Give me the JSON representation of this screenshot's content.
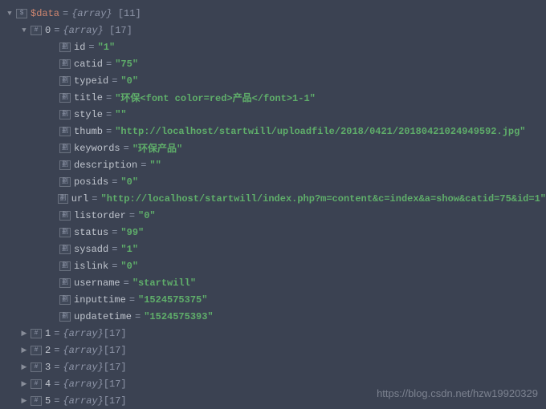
{
  "root": {
    "name": "$data",
    "type": "{array}",
    "count": "[11]"
  },
  "item0": {
    "key": "0",
    "type": "{array}",
    "count": "[17]"
  },
  "fields": [
    {
      "key": "id",
      "value": "\"1\""
    },
    {
      "key": "catid",
      "value": "\"75\""
    },
    {
      "key": "typeid",
      "value": "\"0\""
    },
    {
      "key": "title",
      "value": "\"环保<font color=red>产品</font>1-1\""
    },
    {
      "key": "style",
      "value": "\"\""
    },
    {
      "key": "thumb",
      "value": "\"http://localhost/startwill/uploadfile/2018/0421/20180421024949592.jpg\""
    },
    {
      "key": "keywords",
      "value": "\"环保产品\""
    },
    {
      "key": "description",
      "value": "\"\""
    },
    {
      "key": "posids",
      "value": "\"0\""
    },
    {
      "key": "url",
      "value": "\"http://localhost/startwill/index.php?m=content&c=index&a=show&catid=75&id=1\""
    },
    {
      "key": "listorder",
      "value": "\"0\""
    },
    {
      "key": "status",
      "value": "\"99\""
    },
    {
      "key": "sysadd",
      "value": "\"1\""
    },
    {
      "key": "islink",
      "value": "\"0\""
    },
    {
      "key": "username",
      "value": "\"startwill\""
    },
    {
      "key": "inputtime",
      "value": "\"1524575375\""
    },
    {
      "key": "updatetime",
      "value": "\"1524575393\""
    }
  ],
  "siblings": [
    {
      "key": "1",
      "type": "{array}",
      "count": "[17]"
    },
    {
      "key": "2",
      "type": "{array}",
      "count": "[17]"
    },
    {
      "key": "3",
      "type": "{array}",
      "count": "[17]"
    },
    {
      "key": "4",
      "type": "{array}",
      "count": "[17]"
    },
    {
      "key": "5",
      "type": "{array}",
      "count": "[17]"
    }
  ],
  "equals": "=",
  "watermark": "https://blog.csdn.net/hzw19920329"
}
